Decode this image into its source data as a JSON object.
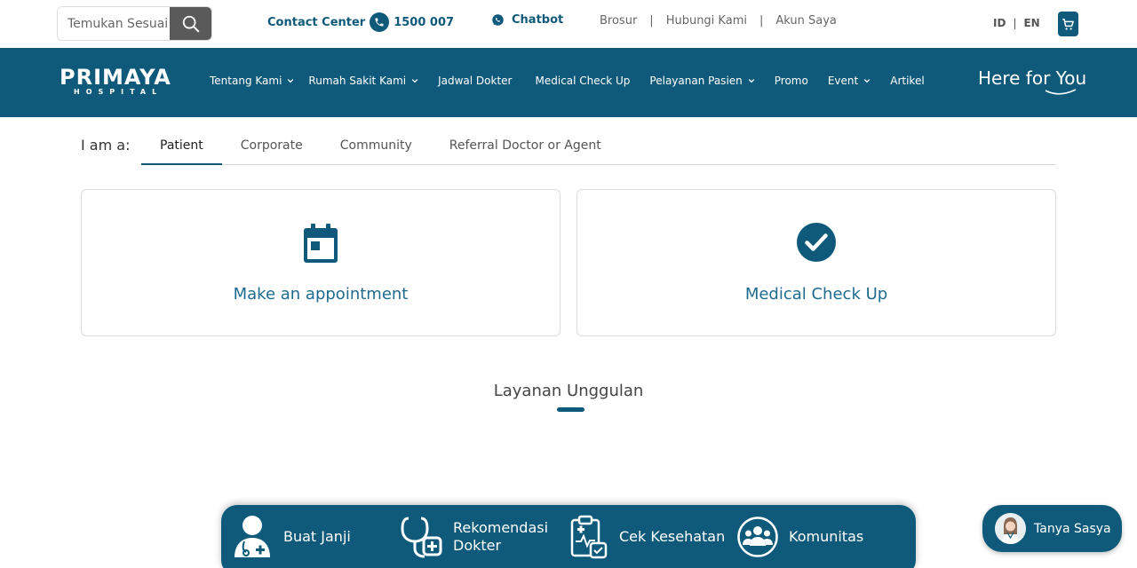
{
  "topbar": {
    "search": {
      "placeholder": "Temukan Sesuai"
    },
    "contact_label": "Contact Center",
    "contact_number": "1500 007",
    "chatbot_label": "Chatbot",
    "links": [
      "Brosur",
      "Hubungi Kami",
      "Akun Saya"
    ],
    "separator": "|",
    "lang": {
      "id": "ID",
      "en": "EN",
      "separator": "|"
    }
  },
  "nav": {
    "brand": "PRIMAYA",
    "brand_sub": "HOSPITAL",
    "items": [
      {
        "label": "Tentang Kami",
        "dropdown": true
      },
      {
        "label": "Rumah Sakit Kami",
        "dropdown": true
      },
      {
        "label": "Jadwal Dokter",
        "dropdown": false
      },
      {
        "label": "Medical Check Up",
        "dropdown": false
      },
      {
        "label": "Pelayanan Pasien",
        "dropdown": true
      },
      {
        "label": "Promo",
        "dropdown": false
      },
      {
        "label": "Event",
        "dropdown": true
      },
      {
        "label": "Artikel",
        "dropdown": false
      }
    ],
    "tagline": "Here for You"
  },
  "roles": {
    "label": "I am a:",
    "tabs": [
      "Patient",
      "Corporate",
      "Community",
      "Referral Doctor or Agent"
    ],
    "active": "Patient"
  },
  "cards": [
    {
      "title": "Make an appointment",
      "icon": "calendar-icon"
    },
    {
      "title": "Medical Check Up",
      "icon": "check-circle-icon"
    }
  ],
  "section": {
    "title": "Layanan Unggulan"
  },
  "dock": [
    {
      "label_lines": [
        "Buat Janji"
      ],
      "icon": "doctor-icon"
    },
    {
      "label_lines": [
        "Rekomendasi",
        "Dokter"
      ],
      "icon": "stethoscope-icon"
    },
    {
      "label_lines": [
        "Cek Kesehatan"
      ],
      "icon": "clipboard-health-icon"
    },
    {
      "label_lines": [
        "Komunitas"
      ],
      "icon": "community-icon"
    }
  ],
  "chat": {
    "label": "Tanya Sasya"
  },
  "colors": {
    "primary": "#0f5a7a",
    "link": "#1e6b8f",
    "search_button": "#5a5a5a"
  }
}
